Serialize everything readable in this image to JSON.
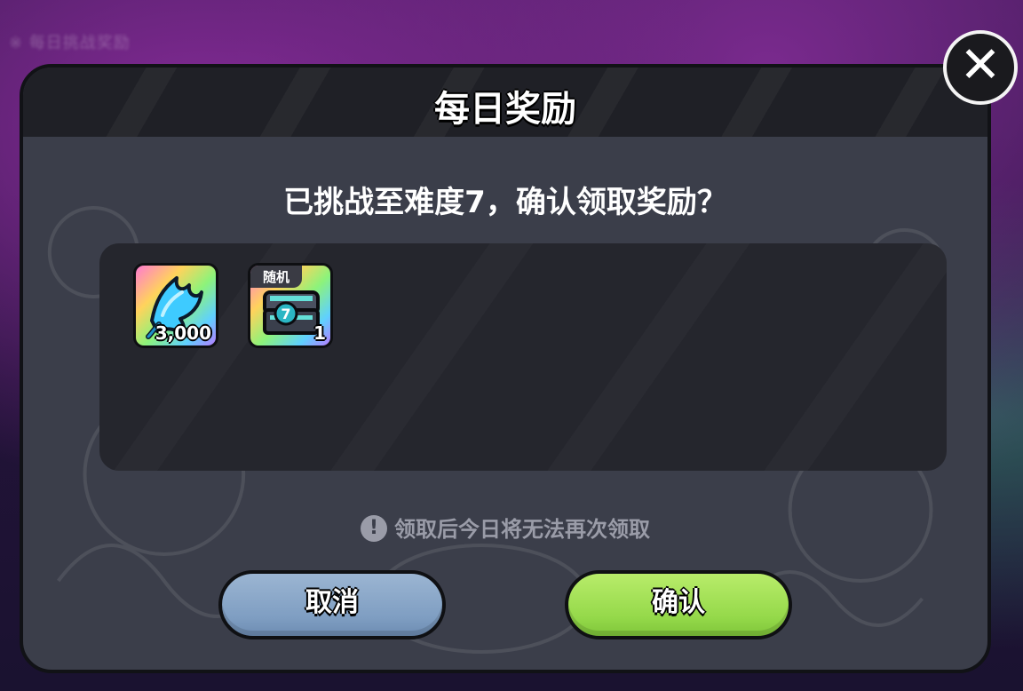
{
  "background": {
    "blurred_text": "※ 每日挑战奖励"
  },
  "dialog": {
    "title": "每日奖励",
    "question": "已挑战至难度7，确认领取奖励？",
    "warning": "领取后今日将无法再次领取",
    "warning_icon": "exclamation-icon",
    "cancel_label": "取消",
    "confirm_label": "确认",
    "close_icon": "close-icon",
    "colors": {
      "panel": "#3b3e4a",
      "header": "#1f2026",
      "cancel": "#8aa7c8",
      "confirm": "#a4e05a"
    }
  },
  "rewards": [
    {
      "icon": "blue-crystal-icon",
      "quantity": "3,000"
    },
    {
      "icon": "random-chest-icon",
      "tag": "随机",
      "quantity": "1"
    }
  ]
}
